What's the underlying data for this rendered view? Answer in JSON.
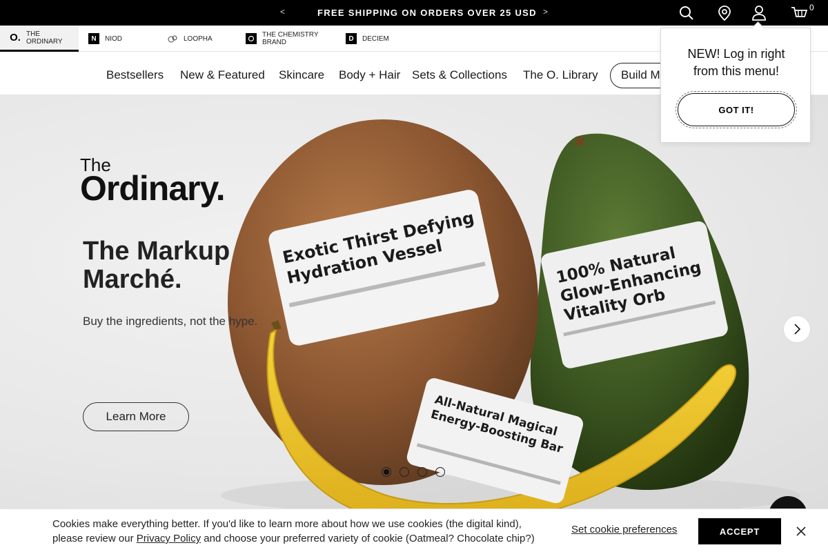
{
  "promo": {
    "prev_label": "<",
    "message": "FREE SHIPPING ON ORDERS OVER 25 USD",
    "next_label": ">",
    "cart_count": "0",
    "icons": [
      "search-icon",
      "location-pin-icon",
      "account-icon",
      "cart-icon"
    ]
  },
  "brands": [
    {
      "name": "THE ORDINARY",
      "logo": "O.",
      "active": true
    },
    {
      "name": "NIOD",
      "logo": "N",
      "active": false
    },
    {
      "name": "LOOPHA",
      "logo": "",
      "active": false
    },
    {
      "name": "THE CHEMISTRY BRAND",
      "logo": "",
      "active": false
    },
    {
      "name": "DECIEM",
      "logo": "D",
      "active": false
    }
  ],
  "nav": {
    "items": [
      "Bestsellers",
      "New & Featured",
      "Skincare",
      "Body + Hair",
      "Sets & Collections",
      "The O. Library"
    ],
    "build_label": "Build My Regimen"
  },
  "hero": {
    "brand_the": "The",
    "brand_name": "Ordinary.",
    "headline": "The Markup Marché.",
    "subtext": "Buy the ingredients, not the hype.",
    "cta": "Learn More",
    "labels": {
      "coconut": [
        "Exotic Thirst Defying",
        "Hydration Vessel"
      ],
      "avocado": [
        "100% Natural",
        "Glow-Enhancing",
        "Vitality Orb"
      ],
      "banana": [
        "All-Natural Magical",
        "Energy-Boosting Bar"
      ]
    },
    "slides_total": 4,
    "active_slide": 1
  },
  "popover": {
    "title": "NEW! Log in right from this menu!",
    "button": "GOT IT!"
  },
  "cookie": {
    "text_before": "Cookies make everything better. If you'd like to learn more about how we use cookies (the digital kind), please review our ",
    "policy_link": "Privacy Policy",
    "text_after": " and choose your preferred variety of cookie (Oatmeal? Chocolate chip?)",
    "prefs_label": "Set cookie preferences",
    "accept_label": "ACCEPT"
  }
}
